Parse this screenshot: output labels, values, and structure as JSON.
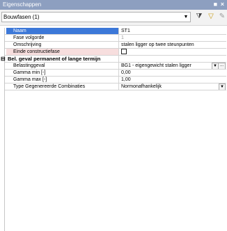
{
  "panel": {
    "title": "Eigenschappen",
    "pin_glyph": "■",
    "close_glyph": "×"
  },
  "toolbar": {
    "selector_value": "Bouwfasen (1)"
  },
  "grid": {
    "rows": [
      {
        "label": "Naam",
        "value": "ST1"
      },
      {
        "label": "Fase volgorde",
        "value": "1"
      },
      {
        "label": "Omschrijving",
        "value": "stalen ligger op twee steunpunten"
      },
      {
        "label": "Einde constructiefase",
        "value": ""
      },
      {
        "label": "Bel. geval permanent of lange termijn",
        "value": ""
      },
      {
        "label": "Belastinggeval",
        "value": "BG1 - eigengewicht stalen ligger"
      },
      {
        "label": "Gamma min [-]",
        "value": "0,00"
      },
      {
        "label": "Gamma max [-]",
        "value": "1,00"
      },
      {
        "label": "Type Gegenereerde Combinaties",
        "value": "Normonafhankelijk"
      }
    ],
    "collapse_glyph": "⊟"
  }
}
